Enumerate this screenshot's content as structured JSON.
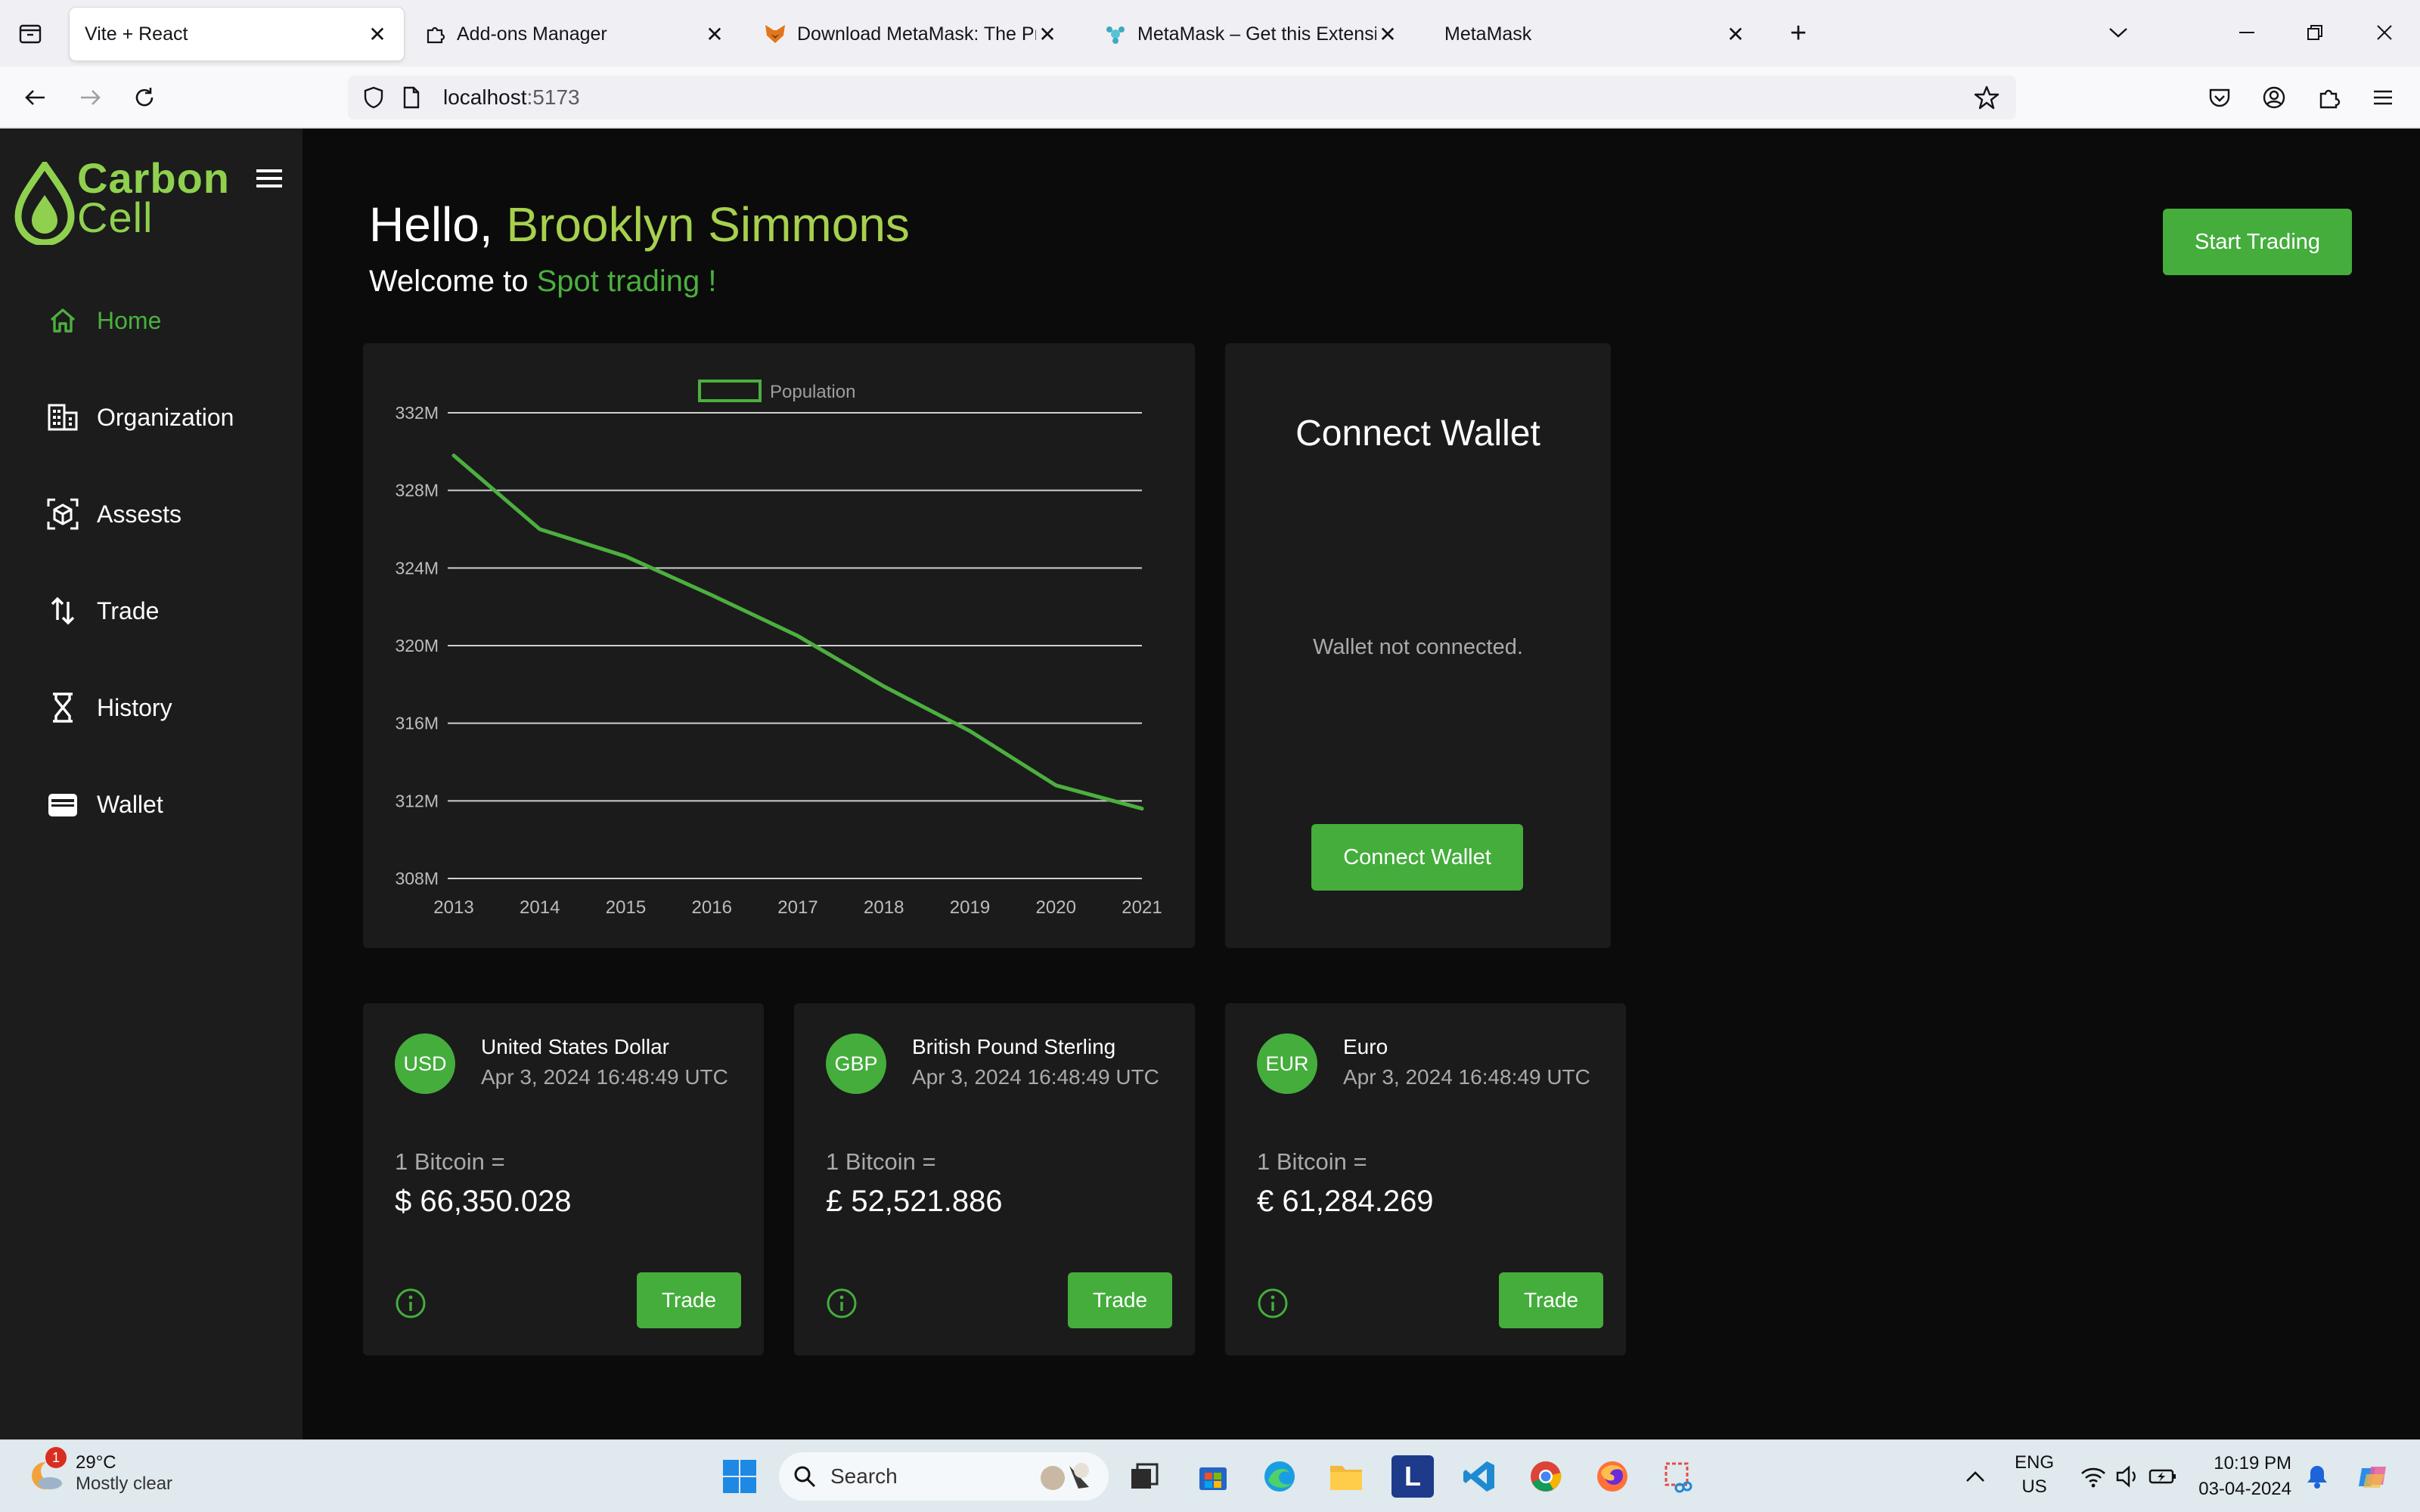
{
  "browser": {
    "tabs": [
      {
        "title": "Vite + React",
        "icon": "vite-icon",
        "active": true
      },
      {
        "title": "Add-ons Manager",
        "icon": "puzzle-icon",
        "active": false
      },
      {
        "title": "Download MetaMask: The Prem",
        "icon": "metamask-fox-icon",
        "active": false
      },
      {
        "title": "MetaMask – Get this Extension",
        "icon": "addons-icon",
        "active": false
      },
      {
        "title": "MetaMask",
        "icon": "",
        "active": false
      }
    ],
    "url_host": "localhost",
    "url_port": ":5173"
  },
  "app": {
    "logo_line1": "Carbon",
    "logo_line2": "Cell",
    "nav": [
      {
        "label": "Home",
        "icon": "home-icon",
        "active": true
      },
      {
        "label": "Organization",
        "icon": "organization-icon",
        "active": false
      },
      {
        "label": "Assests",
        "icon": "assets-icon",
        "active": false
      },
      {
        "label": "Trade",
        "icon": "trade-arrows-icon",
        "active": false
      },
      {
        "label": "History",
        "icon": "hourglass-icon",
        "active": false
      },
      {
        "label": "Wallet",
        "icon": "wallet-icon",
        "active": false
      }
    ],
    "greeting_prefix": "Hello, ",
    "user_name": "Brooklyn Simmons",
    "welcome_prefix": "Welcome to ",
    "welcome_accent": "Spot trading !",
    "start_trading_label": "Start Trading",
    "wallet": {
      "title": "Connect Wallet",
      "status": "Wallet not connected.",
      "button_label": "Connect Wallet"
    },
    "currencies": [
      {
        "code": "USD",
        "name": "United States Dollar",
        "date": "Apr 3, 2024 16:48:49 UTC",
        "label": "1 Bitcoin =",
        "value": "$ 66,350.028",
        "button": "Trade"
      },
      {
        "code": "GBP",
        "name": "British Pound Sterling",
        "date": "Apr 3, 2024 16:48:49 UTC",
        "label": "1 Bitcoin =",
        "value": "£ 52,521.886",
        "button": "Trade"
      },
      {
        "code": "EUR",
        "name": "Euro",
        "date": "Apr 3, 2024 16:48:49 UTC",
        "label": "1 Bitcoin =",
        "value": "€ 61,284.269",
        "button": "Trade"
      }
    ],
    "accent_color": "#44ad3c"
  },
  "chart_data": {
    "type": "line",
    "title": "",
    "xlabel": "",
    "ylabel": "",
    "categories": [
      "2013",
      "2014",
      "2015",
      "2016",
      "2017",
      "2018",
      "2019",
      "2020",
      "2021"
    ],
    "y_ticks": [
      "308M",
      "312M",
      "316M",
      "320M",
      "324M",
      "328M",
      "332M"
    ],
    "ylim": [
      308,
      332
    ],
    "series": [
      {
        "name": "Population",
        "color": "#4caf3f",
        "values": [
          329.8,
          326.0,
          324.6,
          322.6,
          320.5,
          317.9,
          315.6,
          312.8,
          311.6
        ]
      }
    ],
    "legend": "top-center",
    "grid": true
  },
  "taskbar": {
    "temp": "29°C",
    "condition": "Mostly clear",
    "weather_badge": "1",
    "search_label": "Search",
    "lang1": "ENG",
    "lang2": "US",
    "time": "10:19 PM",
    "date": "03-04-2024"
  }
}
